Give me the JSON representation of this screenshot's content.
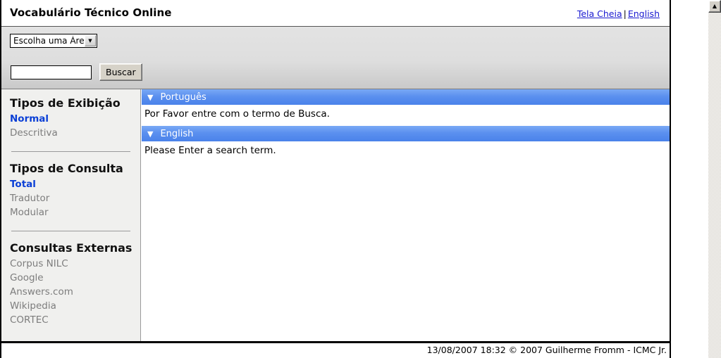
{
  "header": {
    "title": "Vocabulário Técnico Online",
    "links": [
      {
        "label": "Tela Cheia"
      },
      {
        "label": "English"
      }
    ],
    "separator": "|"
  },
  "toolbar": {
    "area_select": {
      "selected": "Escolha uma Área",
      "arrow_icon": "chevron-down-icon"
    },
    "search": {
      "value": "",
      "placeholder": ""
    },
    "search_button_label": "Buscar"
  },
  "sidebar": {
    "groups": [
      {
        "heading": "Tipos de Exibição",
        "items": [
          {
            "label": "Normal",
            "active": true
          },
          {
            "label": "Descritiva",
            "active": false
          }
        ]
      },
      {
        "heading": "Tipos de Consulta",
        "items": [
          {
            "label": "Total",
            "active": true
          },
          {
            "label": "Tradutor",
            "active": false
          },
          {
            "label": "Modular",
            "active": false
          }
        ]
      },
      {
        "heading": "Consultas Externas",
        "items": [
          {
            "label": "Corpus NILC",
            "active": false
          },
          {
            "label": "Google",
            "active": false
          },
          {
            "label": "Answers.com",
            "active": false
          },
          {
            "label": "Wikipedia",
            "active": false
          },
          {
            "label": "CORTEC",
            "active": false
          }
        ]
      }
    ]
  },
  "content": {
    "sections": [
      {
        "title": "Português",
        "toggle_icon": "triangle-down-icon",
        "body": "Por Favor entre com o termo de Busca."
      },
      {
        "title": "English",
        "toggle_icon": "triangle-down-icon",
        "body": "Please Enter a search term."
      }
    ]
  },
  "footer": {
    "text": "13/08/2007 18:32 © 2007 Guilherme Fromm - ICMC Jr."
  },
  "scrollbar": {
    "up_arrow_icon": "triangle-up-icon",
    "up_arrow_glyph": "▲"
  },
  "colors": {
    "accent_blue": "#4a82ea",
    "link_blue": "#1919d0",
    "active_blue": "#0a3fd6",
    "muted_gray": "#7d7d7d",
    "sidebar_bg": "#f0f0ee",
    "toolbar_bg": "#dedede"
  }
}
